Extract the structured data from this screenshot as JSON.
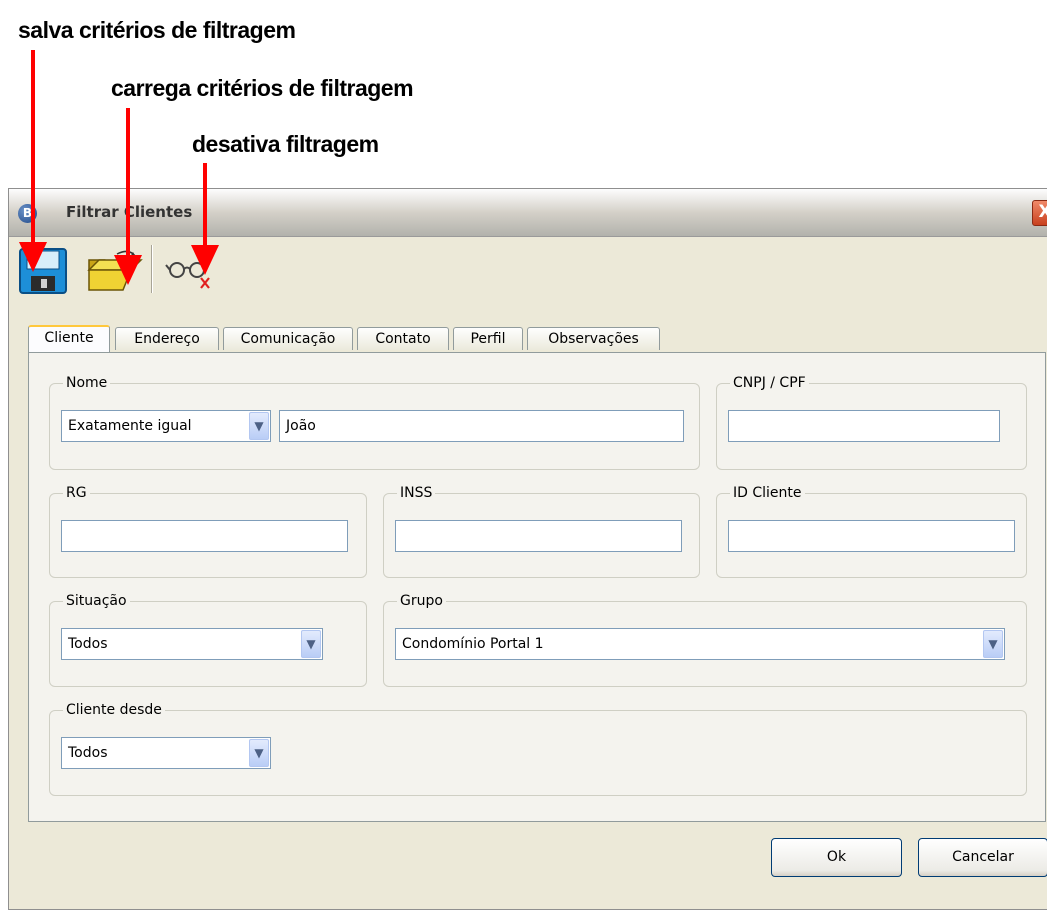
{
  "annotations": {
    "save": "salva critérios de filtragem",
    "load": "carrega critérios de filtragem",
    "disable": "desativa filtragem"
  },
  "window": {
    "title": "Filtrar Clientes",
    "close_label": "X"
  },
  "toolbar": {
    "buttons": [
      {
        "name": "save-filter-button",
        "icon": "floppy-disk-icon"
      },
      {
        "name": "load-filter-button",
        "icon": "open-folder-icon"
      },
      {
        "name": "disable-filter-button",
        "icon": "glasses-x-icon"
      }
    ]
  },
  "tabs": [
    "Cliente",
    "Endereço",
    "Comunicação",
    "Contato",
    "Perfil",
    "Observações"
  ],
  "active_tab": "Cliente",
  "form": {
    "nome": {
      "label": "Nome",
      "match_mode": "Exatamente igual",
      "value": "João"
    },
    "cnpj_cpf": {
      "label": "CNPJ / CPF",
      "value": ""
    },
    "rg": {
      "label": "RG",
      "value": ""
    },
    "inss": {
      "label": "INSS",
      "value": ""
    },
    "id_cliente": {
      "label": "ID Cliente",
      "value": ""
    },
    "situacao": {
      "label": "Situação",
      "value": "Todos"
    },
    "grupo": {
      "label": "Grupo",
      "value": "Condomínio Portal 1"
    },
    "cliente_desde": {
      "label": "Cliente desde",
      "value": "Todos"
    }
  },
  "buttons": {
    "ok": "Ok",
    "cancel": "Cancelar"
  },
  "colors": {
    "arrow": "#ff0000",
    "tab_active_accent": "#ffc83c",
    "input_border": "#7f9db9"
  }
}
